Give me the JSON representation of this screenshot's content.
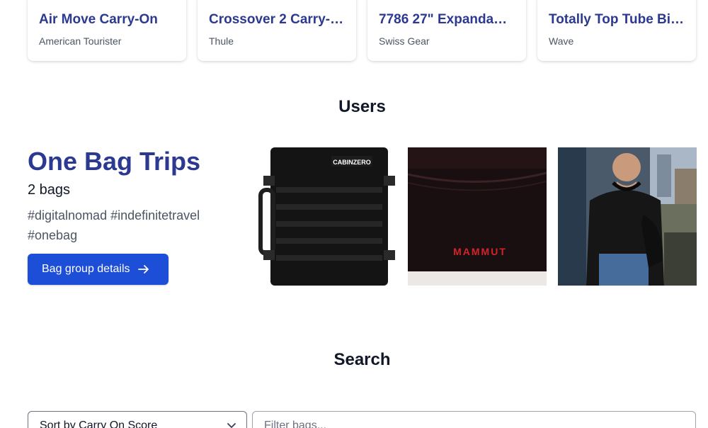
{
  "products": [
    {
      "title": "Air Move Carry-On",
      "brand": "American Tourister"
    },
    {
      "title": "Crossover 2 Carry-…",
      "brand": "Thule"
    },
    {
      "title": "7786 27\" Expandab…",
      "brand": "Swiss Gear"
    },
    {
      "title": "Totally Top Tube Bi…",
      "brand": "Wave"
    }
  ],
  "users_section": {
    "heading": "Users",
    "group": {
      "title": "One Bag Trips",
      "count": "2 bags",
      "tags": "#digitalnomad #indefinitetravel #onebag",
      "button_label": "Bag group details",
      "images": [
        {
          "label": "CABINZERO"
        },
        {
          "label": "MAMMUT"
        },
        {
          "label": ""
        }
      ]
    }
  },
  "search_section": {
    "heading": "Search",
    "sort_value": "Sort by Carry On Score",
    "filter_placeholder": "Filter bags..."
  },
  "colors": {
    "brand_text": "#2b3990",
    "primary_button": "#1d4ed8"
  }
}
